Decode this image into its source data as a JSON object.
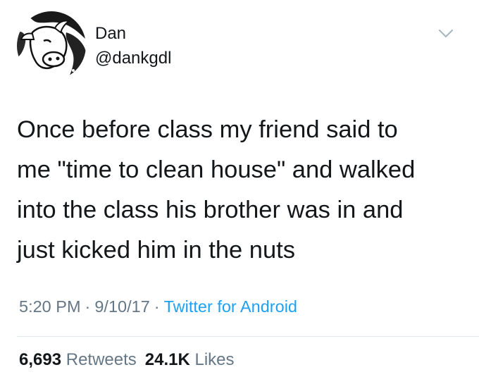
{
  "author": {
    "display_name": "Dan",
    "handle": "@dankgdl",
    "avatar_icon": "cow-head-avatar"
  },
  "menu_icon": "chevron-down-icon",
  "tweet": {
    "lines": [
      "Once before class my friend said to",
      "me \"time to clean house\" and walked",
      "into the class his brother was in and",
      "just kicked him in the nuts"
    ]
  },
  "meta": {
    "time": "5:20 PM",
    "separator": "·",
    "date": "9/10/17",
    "source": "Twitter for Android"
  },
  "stats": {
    "retweets_count": "6,693",
    "retweets_label": "Retweets",
    "likes_count": "24.1K",
    "likes_label": "Likes"
  },
  "colors": {
    "text": "#14171a",
    "secondary": "#657786",
    "link": "#1da1f2",
    "divider": "#e1e8ed"
  }
}
